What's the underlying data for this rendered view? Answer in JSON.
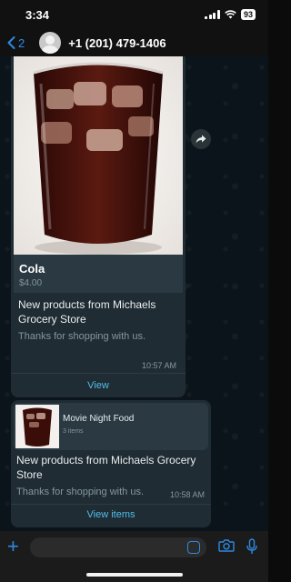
{
  "status_bar": {
    "time": "3:34",
    "battery": "93"
  },
  "header": {
    "back_count": "2",
    "contact": "+1 (201) 479-1406"
  },
  "message1": {
    "product_name": "Cola",
    "price": "$4.00",
    "title": "New products from Michaels Grocery Store",
    "subtitle": "Thanks for shopping with us.",
    "time": "10:57 AM",
    "action": "View"
  },
  "message2": {
    "catalog_title": "Movie Night Food",
    "catalog_count": "3 items",
    "title": "New products from Michaels Grocery Store",
    "subtitle": "Thanks for shopping with us.",
    "time": "10:58 AM",
    "action": "View items"
  },
  "icons": {
    "back": "chevron-left-icon",
    "forward": "share-forward-icon",
    "plus": "plus-icon",
    "sticker": "sticker-icon",
    "camera": "camera-icon",
    "mic": "microphone-icon"
  },
  "colors": {
    "accent": "#2d8ae5",
    "link": "#53bdeb",
    "bubble": "#1f2c33"
  }
}
